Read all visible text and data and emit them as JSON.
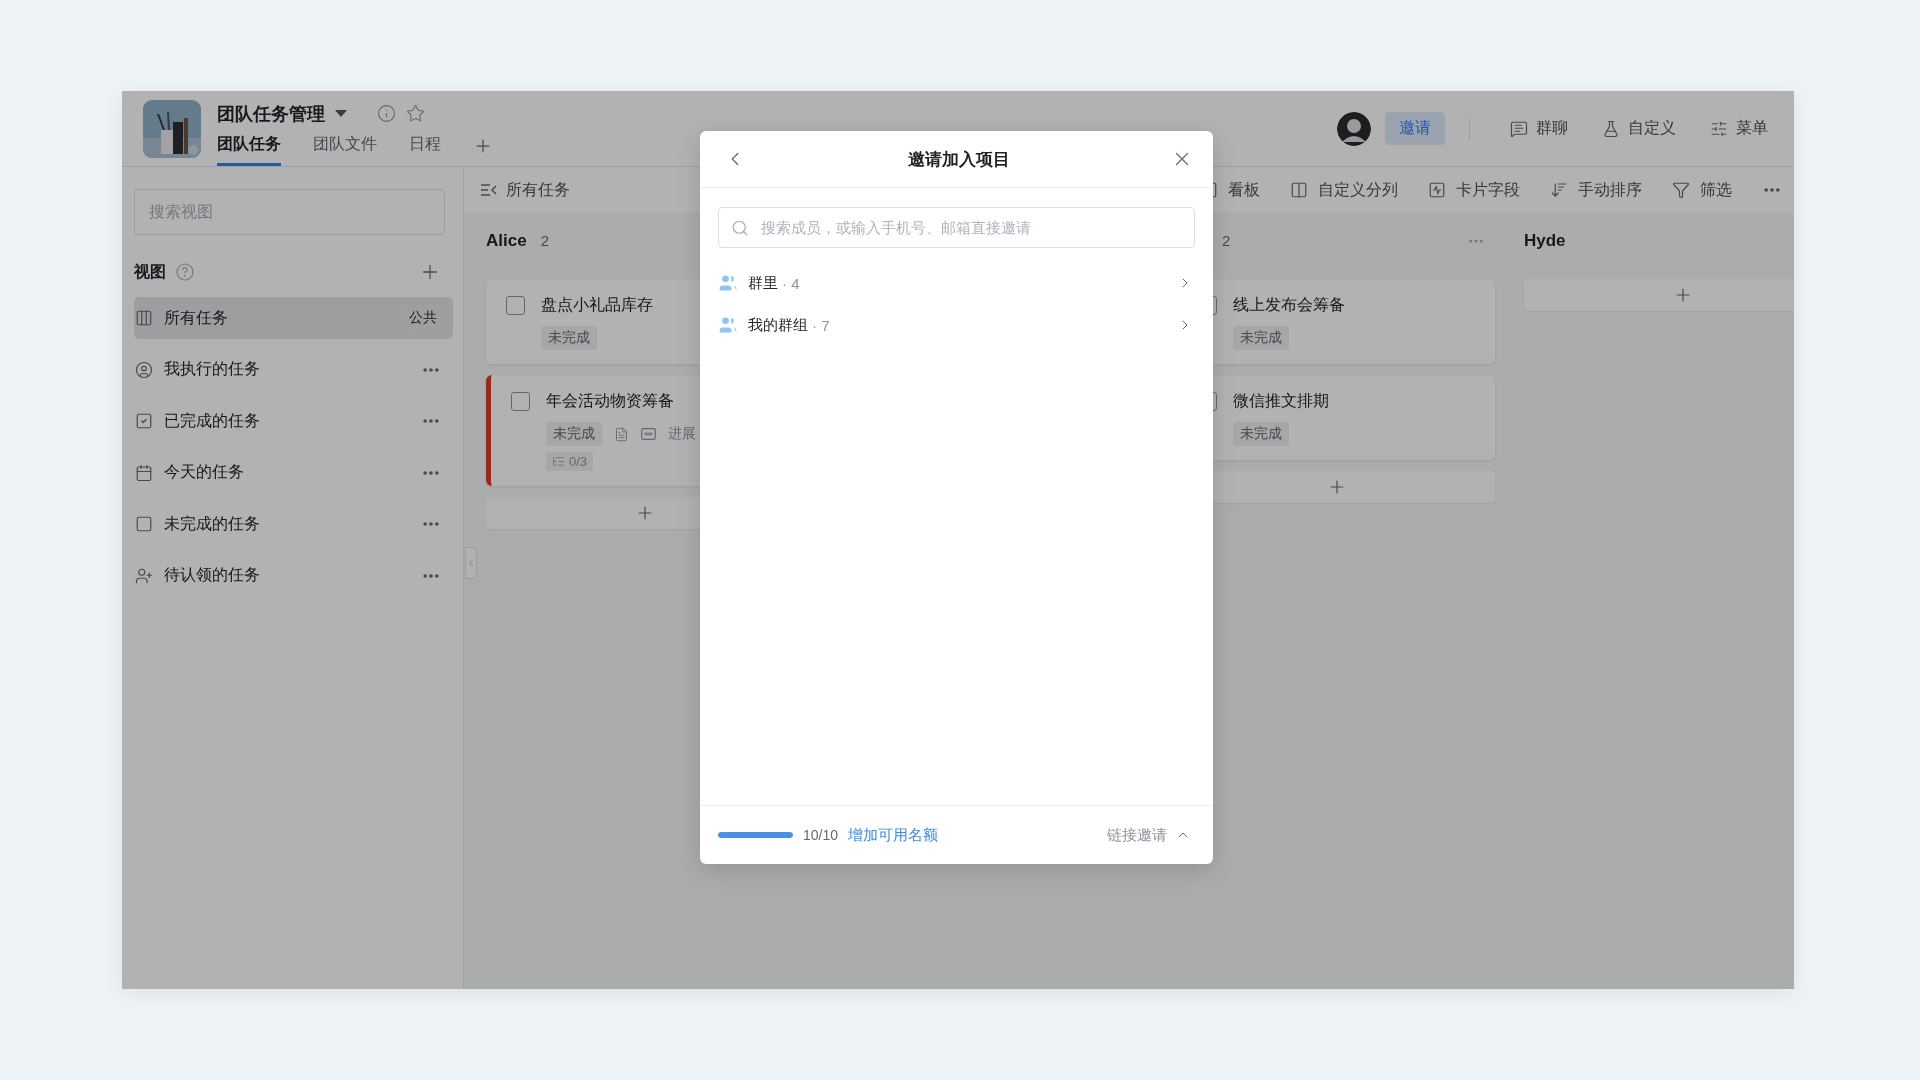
{
  "project": {
    "title": "团队任务管理",
    "tabs": [
      {
        "label": "团队任务",
        "selected": true
      },
      {
        "label": "团队文件",
        "selected": false
      },
      {
        "label": "日程",
        "selected": false
      }
    ]
  },
  "header_actions": {
    "invite": "邀请",
    "items": [
      {
        "kind": "chat",
        "label": "群聊"
      },
      {
        "kind": "custom",
        "label": "自定义"
      },
      {
        "kind": "menu",
        "label": "菜单"
      }
    ]
  },
  "sidebar": {
    "search": {
      "placeholder": "搜索视图"
    },
    "section": "视图",
    "items": [
      {
        "kind": "board",
        "label": "所有任务",
        "badge": "公共",
        "selected": true
      },
      {
        "kind": "mine",
        "label": "我执行的任务",
        "selected": false
      },
      {
        "kind": "done",
        "label": "已完成的任务",
        "selected": false
      },
      {
        "kind": "today",
        "label": "今天的任务",
        "selected": false
      },
      {
        "kind": "open",
        "label": "未完成的任务",
        "selected": false
      },
      {
        "kind": "claim",
        "label": "待认领的任务",
        "selected": false
      }
    ]
  },
  "toolbar": {
    "view": "所有任务",
    "items": [
      {
        "kind": "board",
        "label": "看板"
      },
      {
        "kind": "columns",
        "label": "自定义分列"
      },
      {
        "kind": "fields",
        "label": "卡片字段"
      },
      {
        "kind": "sort",
        "label": "手动排序"
      },
      {
        "kind": "filter",
        "label": "筛选"
      }
    ]
  },
  "board": {
    "columns": [
      {
        "name": "Alice",
        "count": "2",
        "tasks": [
          {
            "title": "盘点小礼品库存",
            "checked": false,
            "urgent": false,
            "status": "未完成"
          },
          {
            "title": "年会活动物资筹备",
            "checked": false,
            "urgent": true,
            "status": "未完成",
            "has_note": true,
            "detail": "进展",
            "subtasks": "0/3"
          }
        ]
      },
      {
        "count": "2",
        "tasks": [
          {
            "title": "线上发布会筹备",
            "checked": false,
            "urgent": false,
            "status": "未完成"
          },
          {
            "title": "微信推文排期",
            "checked": false,
            "urgent": false,
            "status": "未完成"
          }
        ]
      },
      {
        "name": "Hyde"
      }
    ]
  },
  "dialog": {
    "title": "邀请加入项目",
    "search": {
      "placeholder": "搜索成员，或输入手机号、邮箱直接邀请"
    },
    "groups": [
      {
        "name": "群里",
        "count": "· 4"
      },
      {
        "name": "我的群组",
        "count": "· 7"
      }
    ],
    "quota": {
      "level": 1,
      "reading": "10/10"
    },
    "add_quota": "增加可用名额",
    "link_invite": "链接邀请"
  }
}
